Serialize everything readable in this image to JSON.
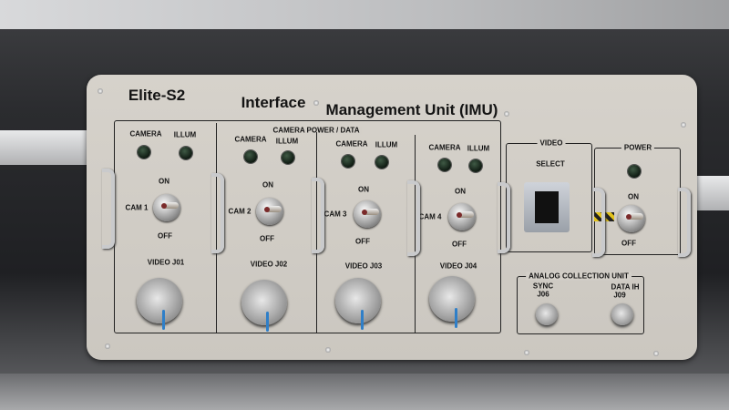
{
  "panel": {
    "model": "Elite-S2",
    "title": "Interface",
    "title2": "Management Unit (IMU)",
    "group_label": "CAMERA POWER / DATA"
  },
  "cameras": [
    {
      "camera_label": "CAMERA",
      "illum_label": "ILLUM",
      "on_label": "ON",
      "off_label": "OFF",
      "switch_label": "CAM 1",
      "video_label": "VIDEO J01"
    },
    {
      "camera_label": "CAMERA",
      "illum_label": "ILLUM",
      "on_label": "ON",
      "off_label": "OFF",
      "switch_label": "CAM 2",
      "video_label": "VIDEO J02"
    },
    {
      "camera_label": "CAMERA",
      "illum_label": "ILLUM",
      "on_label": "ON",
      "off_label": "OFF",
      "switch_label": "CAM 3",
      "video_label": "VIDEO J03"
    },
    {
      "camera_label": "CAMERA",
      "illum_label": "ILLUM",
      "on_label": "ON",
      "off_label": "OFF",
      "switch_label": "CAM 4",
      "video_label": "VIDEO J04"
    }
  ],
  "video": {
    "label": "VIDEO",
    "select_label": "SELECT"
  },
  "power": {
    "label": "POWER",
    "on_label": "ON",
    "off_label": "OFF"
  },
  "analog": {
    "label": "ANALOG COLLECTION UNIT",
    "sync_label": "SYNC",
    "sync_port": "J06",
    "data_label": "DATA IH",
    "data_port": "J09"
  },
  "colors": {
    "panel": "#d3cfc8",
    "led_off": "#1c2e20",
    "cable": "#2f7fc8"
  }
}
